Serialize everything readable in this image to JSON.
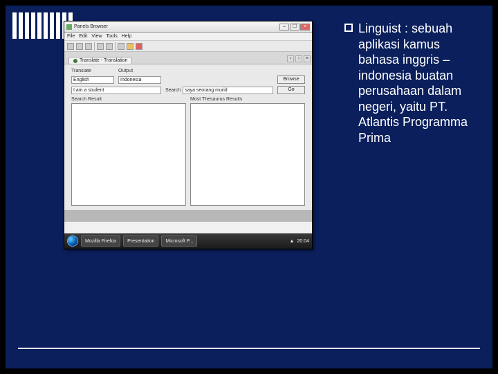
{
  "bullet": {
    "text": "Linguist : sebuah aplikasi kamus bahasa inggris – indonesia buatan perusahaan dalam negeri, yaitu PT. Atlantis Programma Prima"
  },
  "window": {
    "title": "Panels Browser",
    "menu": [
      "File",
      "Edit",
      "View",
      "Tools",
      "Help"
    ],
    "tab": "Translate - Translation",
    "form": {
      "r1c1": "Translate",
      "r1c2": "Output",
      "r2c1": "English",
      "r2c2": "Indonesia",
      "r3c1": "I am a student",
      "r3c2_lbl": "Search",
      "r3c2_val": "saya seorang murid",
      "btn1": "Browse",
      "btn2": "Go"
    },
    "cols": {
      "left": "Search Result",
      "right": "Most Thesaurus Results"
    },
    "task": {
      "b1": "Mozilla Firefox",
      "b2": "Presentation",
      "b3": "Microsoft P...",
      "clock": "20:04"
    }
  }
}
